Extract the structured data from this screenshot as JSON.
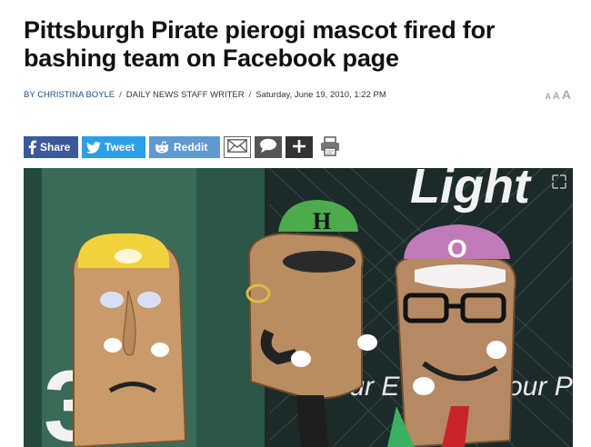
{
  "article": {
    "headline": "Pittsburgh Pirate pierogi mascot fired for bashing team on Facebook page",
    "byline": {
      "by": "BY CHRISTINA BOYLE",
      "role": "DAILY NEWS STAFF WRITER",
      "date": "Saturday, June 19, 2010, 1:22 PM"
    },
    "text_size_labels": [
      "A",
      "A",
      "A"
    ]
  },
  "share_bar": {
    "facebook": "Share",
    "twitter": "Tweet",
    "reddit": "Reddit"
  },
  "photo": {
    "sign_text": "Light",
    "wall_text_left": "Our E",
    "wall_text_right": "our P",
    "wall_number": "3",
    "hat_letters": [
      "H",
      "O"
    ]
  },
  "colors": {
    "facebook": "#3b5998",
    "twitter": "#2ba0e6",
    "reddit": "#5f99cf",
    "byline_link": "#1a4f8f"
  }
}
